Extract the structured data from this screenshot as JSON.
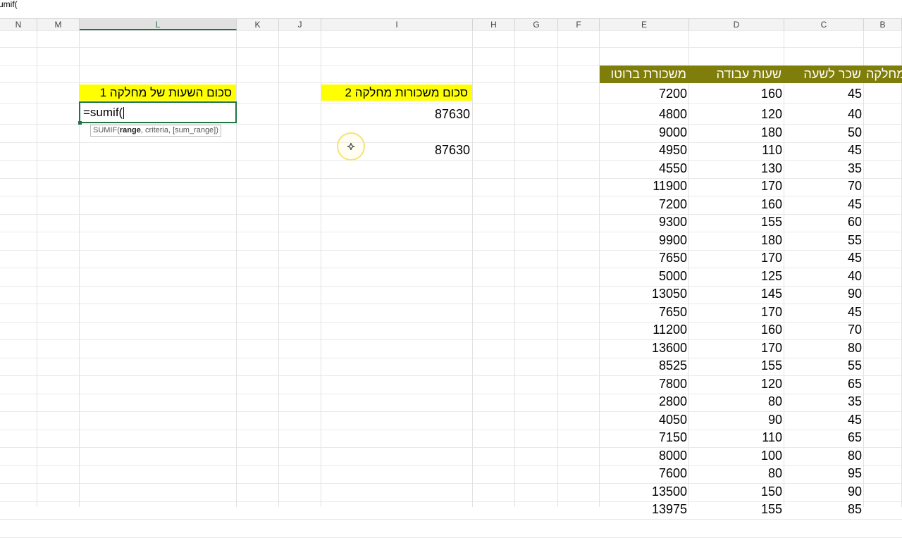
{
  "formula_bar": {
    "text": "umif("
  },
  "columns": [
    {
      "label": "N"
    },
    {
      "label": "M"
    },
    {
      "label": "L"
    },
    {
      "label": "K"
    },
    {
      "label": "J"
    },
    {
      "label": "I"
    },
    {
      "label": "H"
    },
    {
      "label": "G"
    },
    {
      "label": "F"
    },
    {
      "label": "E"
    },
    {
      "label": "D"
    },
    {
      "label": "C"
    },
    {
      "label": "B"
    }
  ],
  "selected_column": "L",
  "summary": {
    "label_dept1": "סכום השעות של מחלקה 1",
    "label_dept2": "סכום משכורות מחלקה 2",
    "result_1": "87630",
    "result_2": "87630"
  },
  "active_cell": {
    "value": "=sumif("
  },
  "tooltip": {
    "func": "SUMIF(",
    "arg1": "range",
    "rest": ", criteria, [sum_range])"
  },
  "table": {
    "headers": {
      "col_e": "משכורת ברוטו",
      "col_d": "שעות עבודה",
      "col_c": "שכר לשעה",
      "col_b": "מחלקה"
    },
    "rows": [
      {
        "e": "7200",
        "d": "160",
        "c": "45"
      },
      {
        "e": "4800",
        "d": "120",
        "c": "40"
      },
      {
        "e": "9000",
        "d": "180",
        "c": "50"
      },
      {
        "e": "4950",
        "d": "110",
        "c": "45"
      },
      {
        "e": "4550",
        "d": "130",
        "c": "35"
      },
      {
        "e": "11900",
        "d": "170",
        "c": "70"
      },
      {
        "e": "7200",
        "d": "160",
        "c": "45"
      },
      {
        "e": "9300",
        "d": "155",
        "c": "60"
      },
      {
        "e": "9900",
        "d": "180",
        "c": "55"
      },
      {
        "e": "7650",
        "d": "170",
        "c": "45"
      },
      {
        "e": "5000",
        "d": "125",
        "c": "40"
      },
      {
        "e": "13050",
        "d": "145",
        "c": "90"
      },
      {
        "e": "7650",
        "d": "170",
        "c": "45"
      },
      {
        "e": "11200",
        "d": "160",
        "c": "70"
      },
      {
        "e": "13600",
        "d": "170",
        "c": "80"
      },
      {
        "e": "8525",
        "d": "155",
        "c": "55"
      },
      {
        "e": "7800",
        "d": "120",
        "c": "65"
      },
      {
        "e": "2800",
        "d": "80",
        "c": "35"
      },
      {
        "e": "4050",
        "d": "90",
        "c": "45"
      },
      {
        "e": "7150",
        "d": "110",
        "c": "65"
      },
      {
        "e": "8000",
        "d": "100",
        "c": "80"
      },
      {
        "e": "7600",
        "d": "80",
        "c": "95"
      },
      {
        "e": "13500",
        "d": "150",
        "c": "90"
      },
      {
        "e": "13975",
        "d": "155",
        "c": "85"
      }
    ]
  },
  "colors": {
    "accent": "#217346",
    "header_olive": "#807e0b",
    "highlight_yellow": "#ffff00"
  }
}
